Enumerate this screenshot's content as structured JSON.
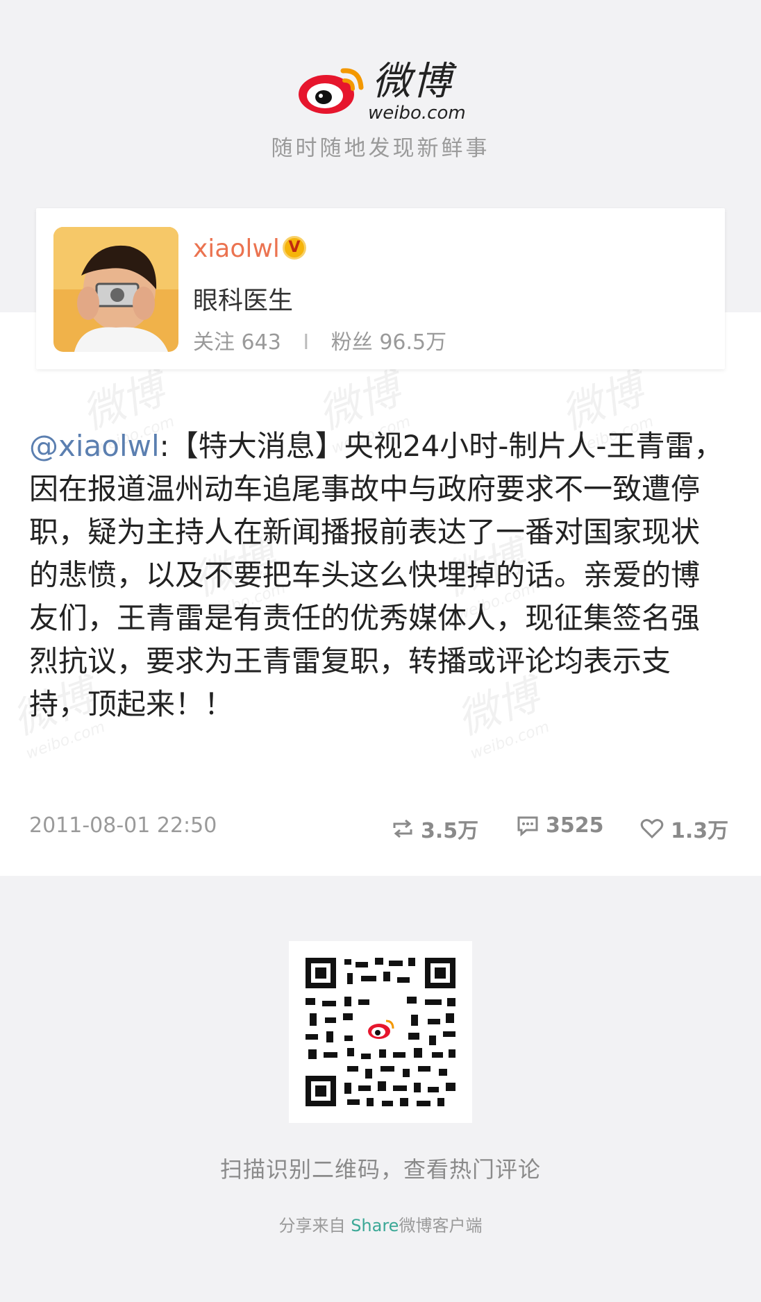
{
  "header": {
    "brand_name": "微博",
    "brand_url": "weibo.com",
    "tagline": "随时随地发现新鲜事"
  },
  "profile": {
    "username": "xiaolwl",
    "verified_badge": "V",
    "bio": "眼科医生",
    "following_label": "关注",
    "following_count": "643",
    "followers_label": "粉丝",
    "followers_count": "96.5万"
  },
  "post": {
    "mention": "@xiaolwl",
    "text": ":【特大消息】央视24小时-制片人-王青雷，因在报道温州动车追尾事故中与政府要求不一致遭停职，疑为主持人在新闻播报前表达了一番对国家现状的悲愤，以及不要把车头这么快埋掉的话。亲爱的博友们，王青雷是有责任的优秀媒体人，现征集签名强烈抗议，要求为王青雷复职，转播或评论均表示支持，顶起来！！",
    "timestamp": "2011-08-01 22:50",
    "reposts": "3.5万",
    "comments": "3525",
    "likes": "1.3万",
    "watermark": "微博",
    "watermark_url": "weibo.com"
  },
  "footer": {
    "qr_caption": "扫描识别二维码，查看热门评论",
    "share_prefix": "分享来自",
    "share_app": "Share",
    "share_suffix": "微博客户端"
  },
  "colors": {
    "accent": "#eb7350",
    "mention": "#5b7fb0",
    "share_link": "#3ba896"
  }
}
